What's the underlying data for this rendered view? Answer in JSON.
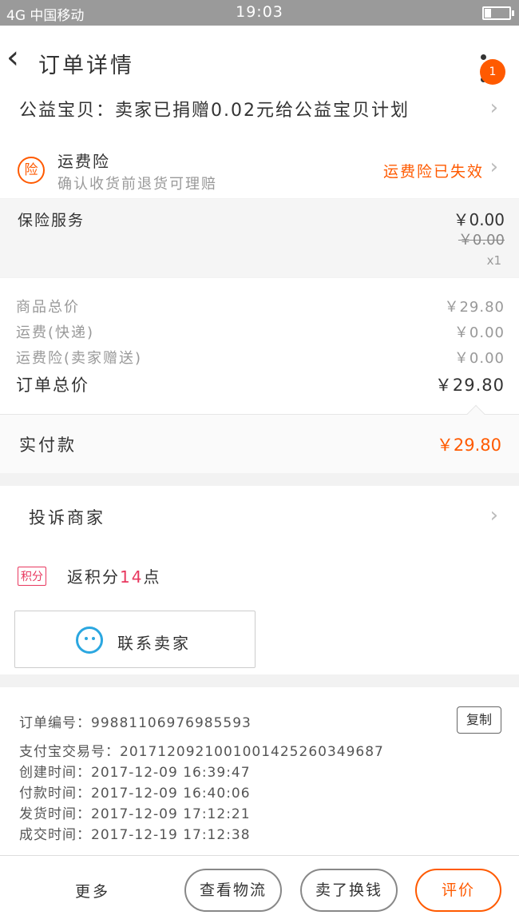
{
  "status_bar": {
    "carrier": "4G 中国移动",
    "time": "19:03"
  },
  "nav": {
    "title": "订单详情",
    "badge": "1"
  },
  "charity": {
    "text": "公益宝贝：卖家已捐赠0.02元给公益宝贝计划"
  },
  "freight_insurance": {
    "icon": "险",
    "name": "运费险",
    "subtitle": "确认收货前退货可理赔",
    "status": "运费险已失效"
  },
  "insurance_service": {
    "name": "保险服务",
    "price": "￥0.00",
    "original_price": "￥0.00",
    "quantity": "x1"
  },
  "summary": {
    "rows": [
      {
        "label": "商品总价",
        "value": "￥29.80"
      },
      {
        "label": "运费(快递)",
        "value": "￥0.00"
      },
      {
        "label": "运费险(卖家赠送)",
        "value": "￥0.00"
      }
    ],
    "total_label": "订单总价",
    "total_value": "￥29.80"
  },
  "paid": {
    "label": "实付款",
    "amount": "￥29.80"
  },
  "complain": {
    "label": "投诉商家"
  },
  "points": {
    "tag": "积分",
    "prefix": "返积分",
    "num": "14",
    "suffix": "点"
  },
  "contact": {
    "label": "联系卖家"
  },
  "order_info": {
    "copy_label": "复制",
    "lines": [
      "订单编号：99881106976985593",
      "支付宝交易号：2017120921001001425260349687",
      "创建时间：2017-12-09 16:39:47",
      "付款时间：2017-12-09 16:40:06",
      "发货时间：2017-12-09 17:12:21",
      "成交时间：2017-12-19 17:12:38"
    ]
  },
  "bottom_bar": {
    "more": "更多",
    "logistics": "查看物流",
    "sell": "卖了换钱",
    "review": "评价"
  },
  "colors": {
    "accent": "#ff5a00",
    "points": "#e8385f",
    "contact_icon": "#2ba7e0"
  }
}
